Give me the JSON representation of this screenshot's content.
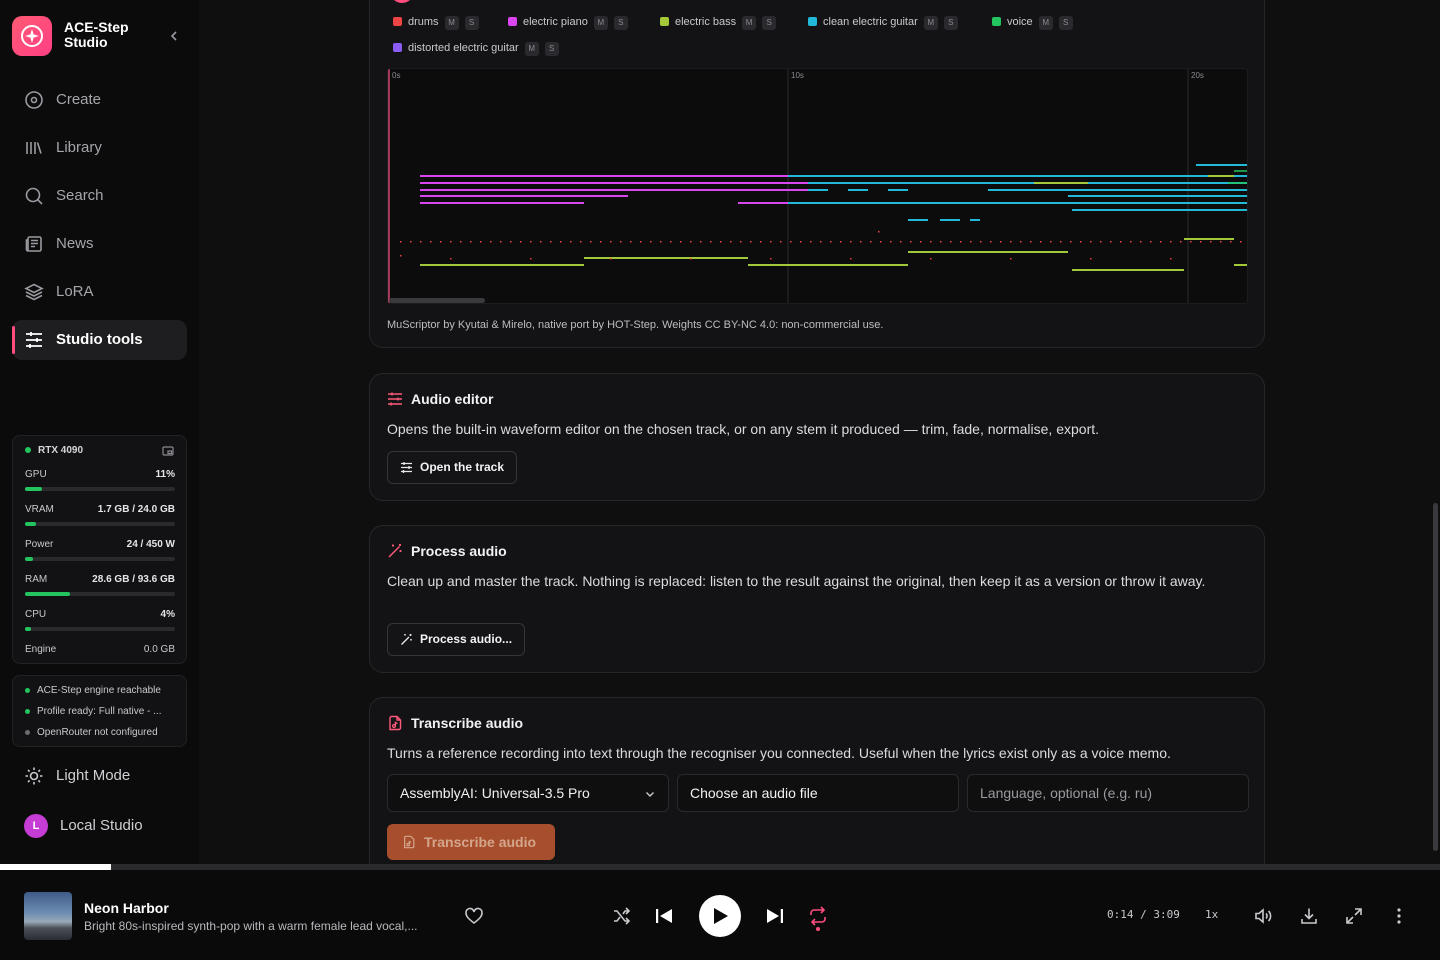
{
  "brand": {
    "name": "ACE-Step Studio"
  },
  "nav": [
    {
      "label": "Create",
      "icon": "create-icon"
    },
    {
      "label": "Library",
      "icon": "library-icon"
    },
    {
      "label": "Search",
      "icon": "search-icon"
    },
    {
      "label": "News",
      "icon": "news-icon"
    },
    {
      "label": "LoRA",
      "icon": "layers-icon"
    },
    {
      "label": "Studio tools",
      "icon": "sliders-icon",
      "active": true
    }
  ],
  "system": {
    "gpu_name": "RTX 4090",
    "metrics": [
      {
        "label": "GPU",
        "value": "11%",
        "fraction": 0.11
      },
      {
        "label": "VRAM",
        "value": "1.7 GB / 24.0 GB",
        "fraction": 0.07
      },
      {
        "label": "Power",
        "value": "24 / 450 W",
        "fraction": 0.05
      },
      {
        "label": "RAM",
        "value": "28.6 GB / 93.6 GB",
        "fraction": 0.3
      },
      {
        "label": "CPU",
        "value": "4%",
        "fraction": 0.04
      }
    ],
    "engine": {
      "label": "Engine",
      "value": "0.0 GB"
    }
  },
  "status": [
    {
      "text": "ACE-Step engine reachable",
      "color": "#22c55e"
    },
    {
      "text": "Profile ready: Full native - ...",
      "color": "#22c55e"
    },
    {
      "text": "OpenRouter not configured",
      "color": "#6b6b70"
    }
  ],
  "theme": {
    "label": "Light Mode"
  },
  "profile": {
    "initial": "L",
    "name": "Local Studio"
  },
  "stems": {
    "legend": [
      {
        "name": "drums",
        "color": "#ef4444"
      },
      {
        "name": "electric piano",
        "color": "#d946ef"
      },
      {
        "name": "electric bass",
        "color": "#a3c93a"
      },
      {
        "name": "clean electric guitar",
        "color": "#22b8d8"
      },
      {
        "name": "voice",
        "color": "#22c55e"
      },
      {
        "name": "distorted electric guitar",
        "color": "#8b5cf6"
      }
    ],
    "mute_label": "M",
    "solo_label": "S",
    "time_marks": [
      "0s",
      "10s",
      "20s"
    ],
    "credits": "MuScriptor by Kyutai & Mirelo, native port by HOT-Step. Weights CC BY-NC 4.0: non-commercial use."
  },
  "audio_editor": {
    "title": "Audio editor",
    "description": "Opens the built-in waveform editor on the chosen track, or on any stem it produced — trim, fade, normalise, export.",
    "button": "Open the track"
  },
  "process_audio": {
    "title": "Process audio",
    "description": "Clean up and master the track. Nothing is replaced: listen to the result against the original, then keep it as a version or throw it away.",
    "button": "Process audio..."
  },
  "transcribe": {
    "title": "Transcribe audio",
    "description": "Turns a reference recording into text through the recogniser you connected. Useful when the lyrics exist only as a voice memo.",
    "model": "AssemblyAI: Universal-3.5 Pro",
    "file_label": "Choose an audio file",
    "language_placeholder": "Language, optional (e.g. ru)",
    "button": "Transcribe audio"
  },
  "player": {
    "title": "Neon Harbor",
    "description": "Bright 80s-inspired synth-pop with a warm female lead vocal,...",
    "time": "0:14 / 3:09",
    "speed": "1x",
    "progress": 0.077
  }
}
